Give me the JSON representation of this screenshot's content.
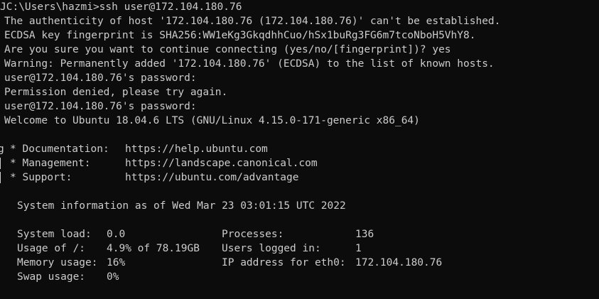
{
  "session": {
    "prompt_line": "JC:\\Users\\hazmi>ssh user@172.104.180.76",
    "auth_warning": "The authenticity of host '172.104.180.76 (172.104.180.76)' can't be established.",
    "fingerprint": "ECDSA key fingerprint is SHA256:WW1eKg3GkqdhhCuo/hSx1buRg3FG6m7tcoNboH5VhY8.",
    "confirm": "Are you sure you want to continue connecting (yes/no/[fingerprint])? yes",
    "known_hosts": "Warning: Permanently added '172.104.180.76' (ECDSA) to the list of known hosts.",
    "password_prompt_1": "user@172.104.180.76's password:",
    "denied": "Permission denied, please try again.",
    "password_prompt_2": "user@172.104.180.76's password:",
    "welcome": "Welcome to Ubuntu 18.04.6 LTS (GNU/Linux 4.15.0-171-generic x86_64)"
  },
  "links": [
    {
      "label": "* Documentation:",
      "url": "https://help.ubuntu.com"
    },
    {
      "label": "* Management:",
      "url": "https://landscape.canonical.com"
    },
    {
      "label": "* Support:",
      "url": "https://ubuntu.com/advantage"
    }
  ],
  "sysinfo": {
    "header": "System information as of Wed Mar 23 03:01:15 UTC 2022",
    "rows": [
      {
        "label1": "System load:",
        "value1": "0.0",
        "label2": "Processes:",
        "value2": "136"
      },
      {
        "label1": "Usage of /:",
        "value1": "4.9% of 78.19GB",
        "label2": "Users logged in:",
        "value2": "1"
      },
      {
        "label1": "Memory usage:",
        "value1": "16%",
        "label2": "IP address for eth0:",
        "value2": "172.104.180.76"
      },
      {
        "label1": "Swap usage:",
        "value1": "0%",
        "label2": "",
        "value2": ""
      }
    ]
  },
  "edge_glyph": "g",
  "colors": {
    "background": "#0c0c0c",
    "text": "#cccccc"
  }
}
